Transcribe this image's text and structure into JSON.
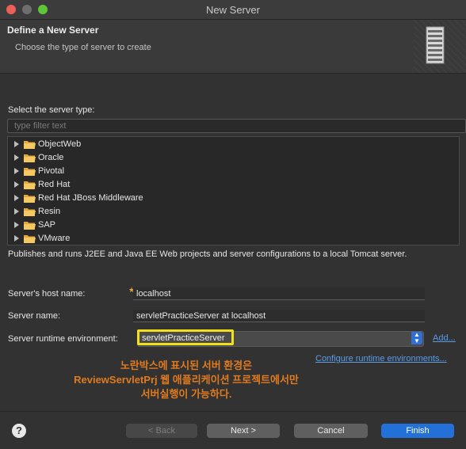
{
  "window": {
    "title": "New Server"
  },
  "header": {
    "title": "Define a New Server",
    "subtitle": "Choose the type of server to create"
  },
  "server_type": {
    "label": "Select the server type:",
    "filter_placeholder": "type filter text",
    "items": [
      {
        "label": "ObjectWeb"
      },
      {
        "label": "Oracle"
      },
      {
        "label": "Pivotal"
      },
      {
        "label": "Red Hat"
      },
      {
        "label": "Red Hat JBoss Middleware"
      },
      {
        "label": "Resin"
      },
      {
        "label": "SAP"
      },
      {
        "label": "VMware"
      }
    ],
    "description": "Publishes and runs J2EE and Java EE Web projects and server configurations to a local Tomcat server."
  },
  "form": {
    "host_label": "Server's host name:",
    "host_value": "localhost",
    "name_label": "Server name:",
    "name_value": "servletPracticeServer at localhost",
    "runtime_label": "Server runtime environment:",
    "runtime_value": "servletPracticeServer",
    "add_link": "Add...",
    "configure_link": "Configure runtime environments..."
  },
  "annotation": {
    "line1": "노란박스에 표시된 서버 환경은",
    "line2": "ReviewServletPrj 웹 애플리케이션 프로젝트에서만",
    "line3": "서버실행이 가능하다."
  },
  "buttons": {
    "back": "< Back",
    "next": "Next >",
    "cancel": "Cancel",
    "finish": "Finish",
    "help": "?"
  },
  "colors": {
    "highlight": "#f2e11a",
    "annotation": "#e07a1f",
    "primary_button": "#2470d9",
    "link": "#5b9be6"
  }
}
